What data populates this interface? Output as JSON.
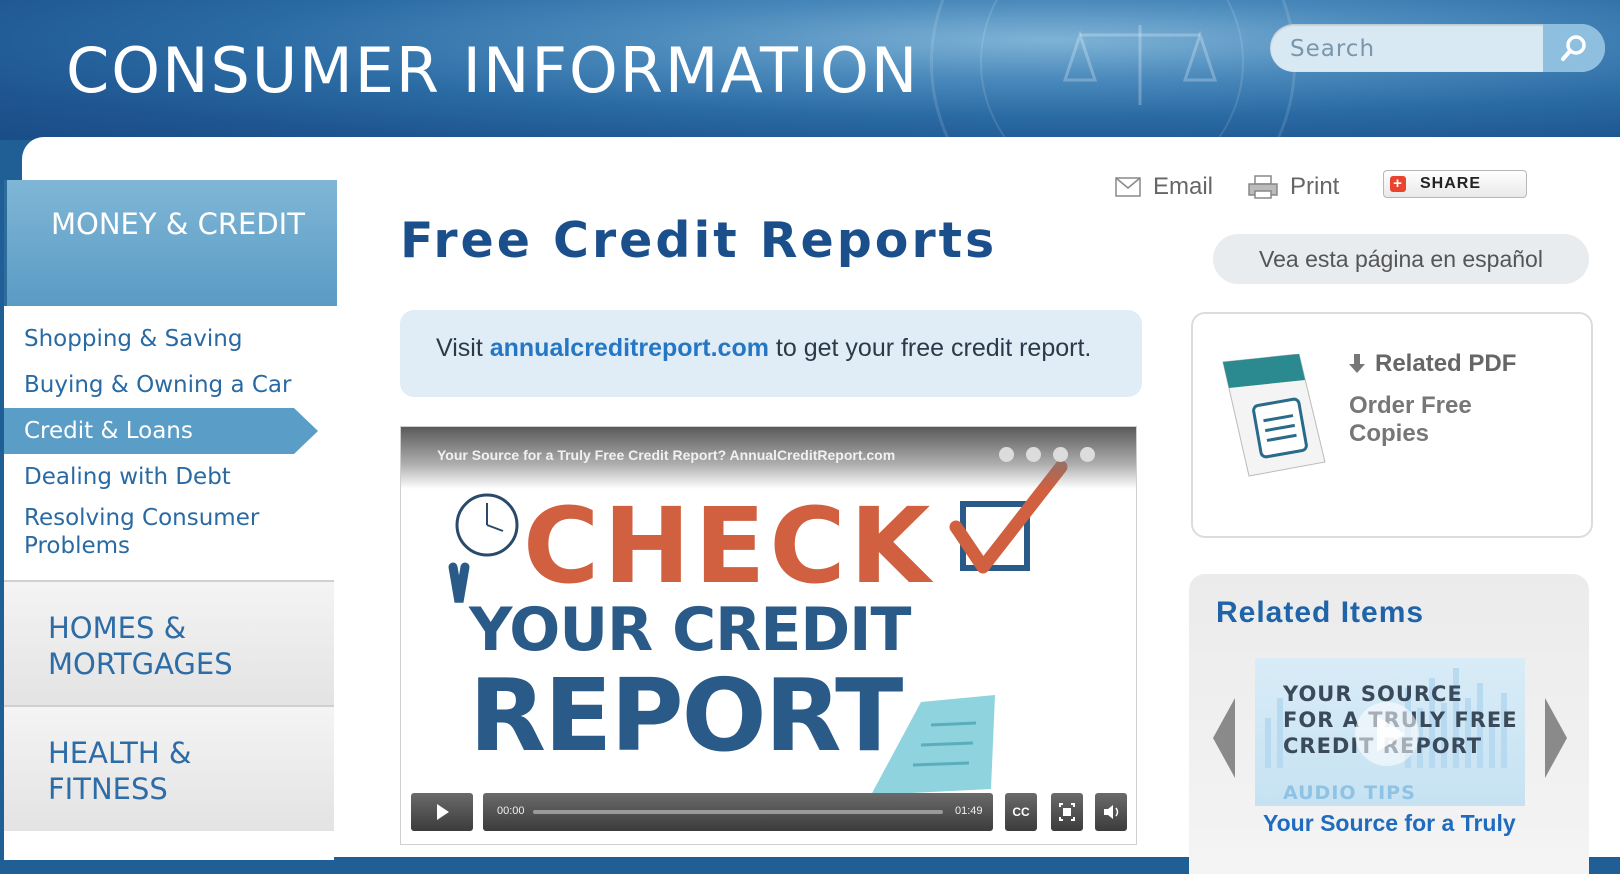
{
  "header": {
    "site_title": "CONSUMER INFORMATION",
    "search_placeholder": "Search"
  },
  "sidebar": {
    "active_category": "MONEY & CREDIT",
    "subnav": [
      {
        "label": "Shopping & Saving",
        "active": false
      },
      {
        "label": "Buying & Owning a Car",
        "active": false
      },
      {
        "label": "Credit & Loans",
        "active": true
      },
      {
        "label": "Dealing with Debt",
        "active": false
      },
      {
        "label": "Resolving Consumer Problems",
        "active": false
      }
    ],
    "categories": [
      "HOMES & MORTGAGES",
      "HEALTH & FITNESS"
    ]
  },
  "tools": {
    "email_label": "Email",
    "print_label": "Print",
    "share_label": "SHARE"
  },
  "main": {
    "title": "Free Credit Reports",
    "spanish_link": "Vea esta página en español",
    "notice_prefix": "Visit ",
    "notice_link": "annualcreditreport.com",
    "notice_suffix": " to get your free credit report."
  },
  "video": {
    "title": "Your Source for a Truly Free Credit Report? AnnualCreditReport.com",
    "art_line1": "CHECK",
    "art_line2": "YOUR CREDIT",
    "art_line3": "REPORT",
    "current_time": "00:00",
    "duration": "01:49",
    "cc_label": "CC"
  },
  "pdf": {
    "label": "Related PDF",
    "title": "Order Free Copies"
  },
  "related": {
    "heading": "Related Items",
    "thumb_line1": "YOUR SOURCE",
    "thumb_line2": "FOR A TRULY FREE",
    "thumb_line3": "CREDIT REPORT",
    "thumb_tag": "AUDIO TIPS",
    "caption": "Your Source for a Truly"
  },
  "colors": {
    "brand_blue": "#1a4f8c",
    "link_blue": "#2577c4",
    "check_orange": "#d0603f",
    "sidebar_active": "#5a9ec8"
  }
}
